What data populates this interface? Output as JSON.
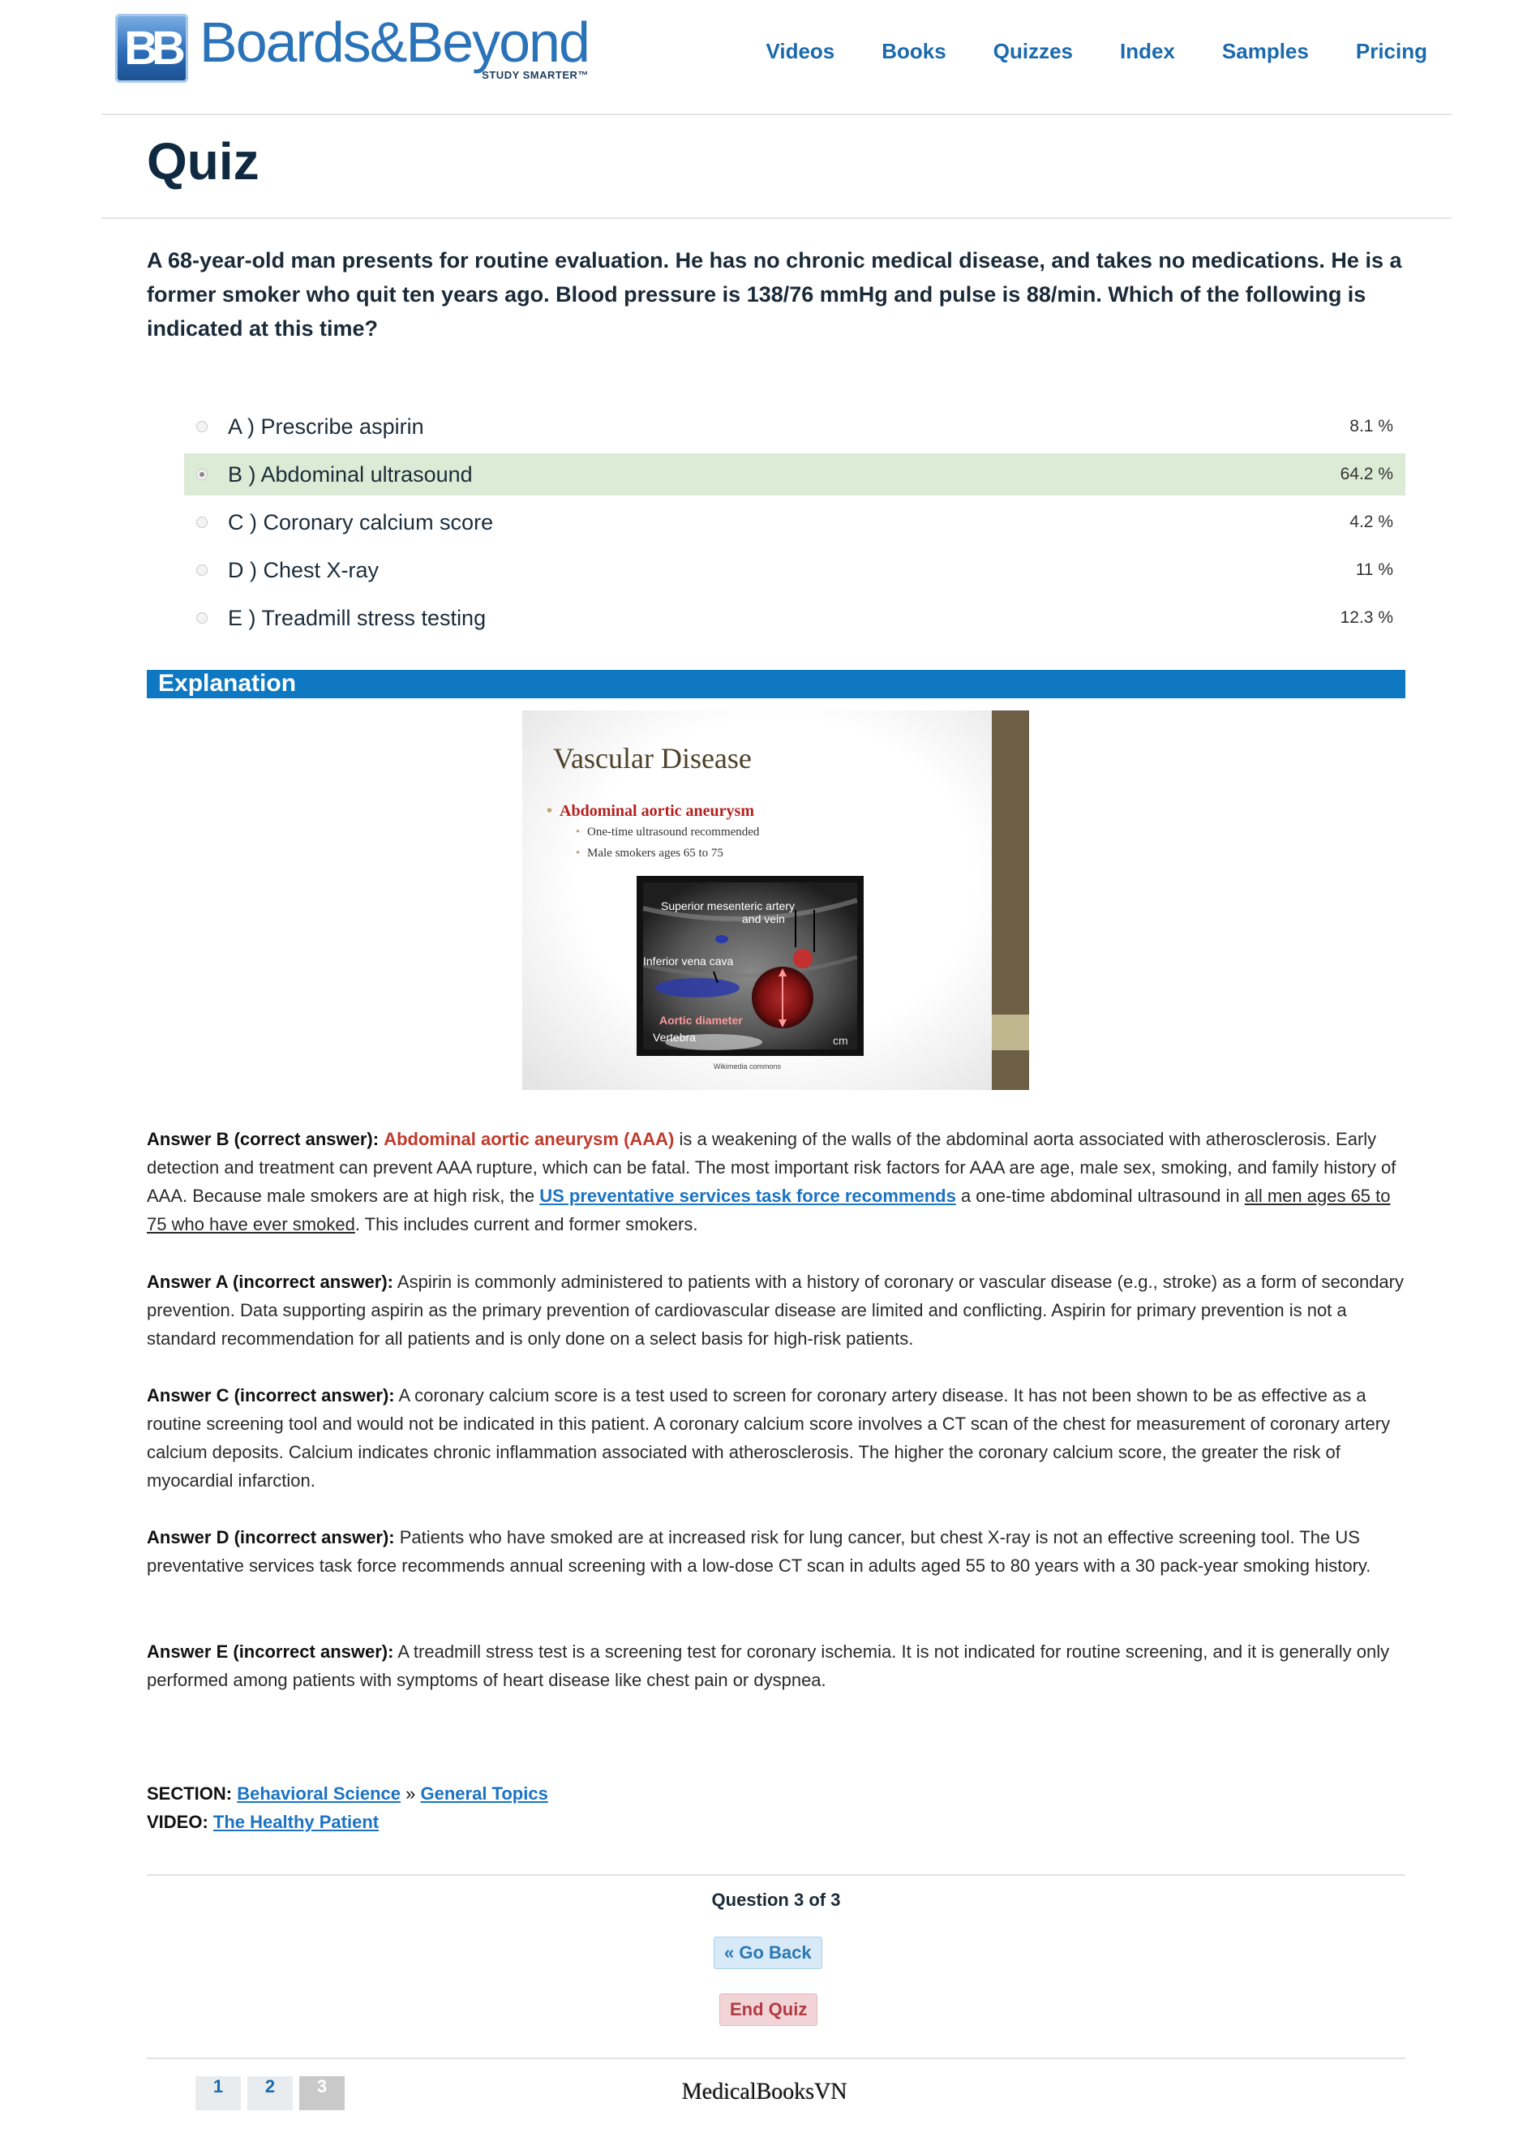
{
  "header": {
    "logo_mark": "BB",
    "logo_name": "Boards&Beyond",
    "logo_tagline": "STUDY SMARTER™",
    "nav": [
      "Videos",
      "Books",
      "Quizzes",
      "Index",
      "Samples",
      "Pricing"
    ]
  },
  "page_title": "Quiz",
  "question": "A 68-year-old man presents for routine evaluation. He has no chronic medical disease, and takes no medications. He is a former smoker who quit ten years ago. Blood pressure is 138/76 mmHg and pulse is 88/min. Which of the following is indicated at this time?",
  "answers": [
    {
      "label": "A ) Prescribe aspirin",
      "pct": "8.1 %"
    },
    {
      "label": "B ) Abdominal ultrasound",
      "pct": "64.2 %"
    },
    {
      "label": "C ) Coronary calcium score",
      "pct": "4.2 %"
    },
    {
      "label": "D ) Chest X-ray",
      "pct": "11 %"
    },
    {
      "label": "E ) Treadmill stress testing",
      "pct": "12.3 %"
    }
  ],
  "selected_answer": "B",
  "explanation_heading": "Explanation",
  "slide": {
    "title": "Vascular Disease",
    "bullet": "Abdominal aortic aneurysm",
    "sub1": "One-time ultrasound recommended",
    "sub2": "Male smokers ages 65 to 75",
    "us_label1": "Superior mesenteric artery",
    "us_label1b": "and vein",
    "us_label2": "Inferior vena cava",
    "us_label3": "Aortic diameter",
    "us_label4": "Vertebra",
    "us_unit": "cm",
    "credit": "Wikimedia commons"
  },
  "explanations": {
    "b_head": "Answer B (correct answer):",
    "b_red": "Abdominal aortic aneurysm (AAA)",
    "b_text1": " is a weakening of the walls of the abdominal aorta associated with atherosclerosis. Early detection and treatment can prevent AAA rupture, which can be fatal. The most important risk factors for AAA are age, male sex, smoking, and family history of AAA. Because male smokers are at high risk, the ",
    "b_link": "US preventative services task force recommends",
    "b_text2": " a one-time abdominal ultrasound in ",
    "b_ul": "all men ages 65 to 75 who have ever smoked",
    "b_text3": ". This includes current and former smokers.",
    "a_head": "Answer A (incorrect answer):",
    "a_text": " Aspirin is commonly administered to patients with a history of coronary or vascular disease (e.g., stroke) as a form of secondary prevention. Data supporting aspirin as the primary prevention of cardiovascular disease are limited and conflicting. Aspirin for primary prevention is not a standard recommendation for all patients and is only done on a select basis for high-risk patients.",
    "c_head": "Answer C (incorrect answer):",
    "c_text": " A coronary calcium score is a test used to screen for coronary artery disease. It has not been shown to be as effective as a routine screening tool and would not be indicated in this patient. A coronary calcium score involves a CT scan of the chest for measurement of coronary artery calcium deposits. Calcium indicates chronic inflammation associated with atherosclerosis. The higher the coronary calcium score, the greater the risk of myocardial infarction.",
    "d_head": "Answer D (incorrect answer):",
    "d_text": " Patients who have smoked are at increased risk for lung cancer, but chest X-ray is not an effective screening tool. The US preventative services task force recommends annual screening with a low-dose CT scan in adults aged 55 to 80 years with a 30 pack-year smoking history.",
    "e_head": "Answer E (incorrect answer):",
    "e_text": " A treadmill stress test is a screening test for coronary ischemia. It is not indicated for routine screening, and it is generally only performed among patients with symptoms of heart disease like chest pain or dyspnea."
  },
  "meta": {
    "section_label": "SECTION:",
    "section_link1": "Behavioral Science",
    "section_sep": " » ",
    "section_link2": "General Topics",
    "video_label": "VIDEO:",
    "video_link": "The Healthy Patient"
  },
  "footer": {
    "question_count": "Question 3 of 3",
    "go_back": "« Go Back",
    "end_quiz": "End Quiz",
    "pages": [
      "1",
      "2",
      "3"
    ],
    "active_page": "3",
    "watermark": "MedicalBooksVN"
  },
  "colors": {
    "brand_blue": "#2b73b9",
    "explanation_bar": "#0f78c2",
    "selected_row": "#dcebd5",
    "correct_red": "#c0392b"
  }
}
